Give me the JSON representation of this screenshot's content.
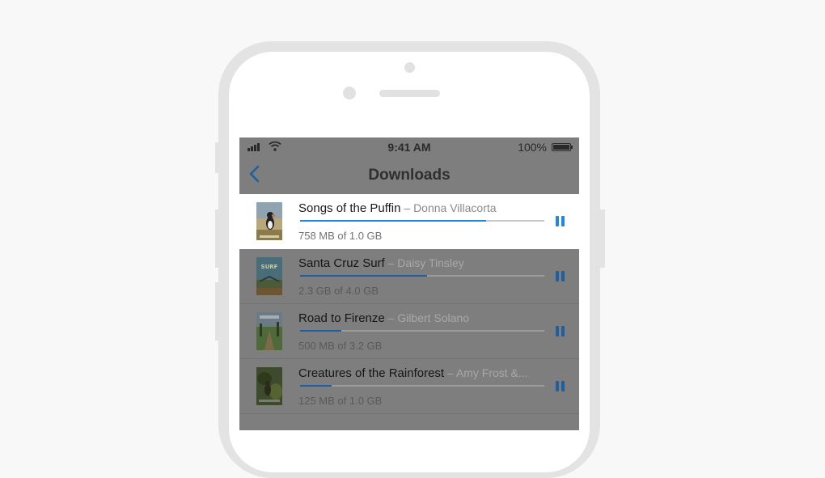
{
  "status_bar": {
    "time": "9:41 AM",
    "battery_percent": "100%",
    "icons": [
      "signal-icon",
      "wifi-icon",
      "battery-icon"
    ]
  },
  "nav": {
    "title": "Downloads",
    "back_icon": "chevron-left-icon"
  },
  "colors": {
    "accent": "#1e88e5",
    "overlay": "#7e7e7e"
  },
  "downloads": [
    {
      "title": "Songs of the Puffin",
      "separator": " – ",
      "author": "Donna Villacorta",
      "size": "758 MB of 1.0 GB",
      "progress": 0.76,
      "active": true
    },
    {
      "title": "Santa Cruz Surf",
      "separator": " – ",
      "author": "Daisy Tinsley",
      "size": "2.3 GB of 4.0 GB",
      "progress": 0.52,
      "active": false,
      "cover_text": "SURF"
    },
    {
      "title": "Road to Firenze",
      "separator": " – ",
      "author": "Gilbert Solano",
      "size": "500 MB of 3.2 GB",
      "progress": 0.17,
      "active": false
    },
    {
      "title": "Creatures of the Rainforest",
      "separator": " – ",
      "author": "Amy Frost &...",
      "size": "125 MB of 1.0 GB",
      "progress": 0.13,
      "active": false
    }
  ]
}
